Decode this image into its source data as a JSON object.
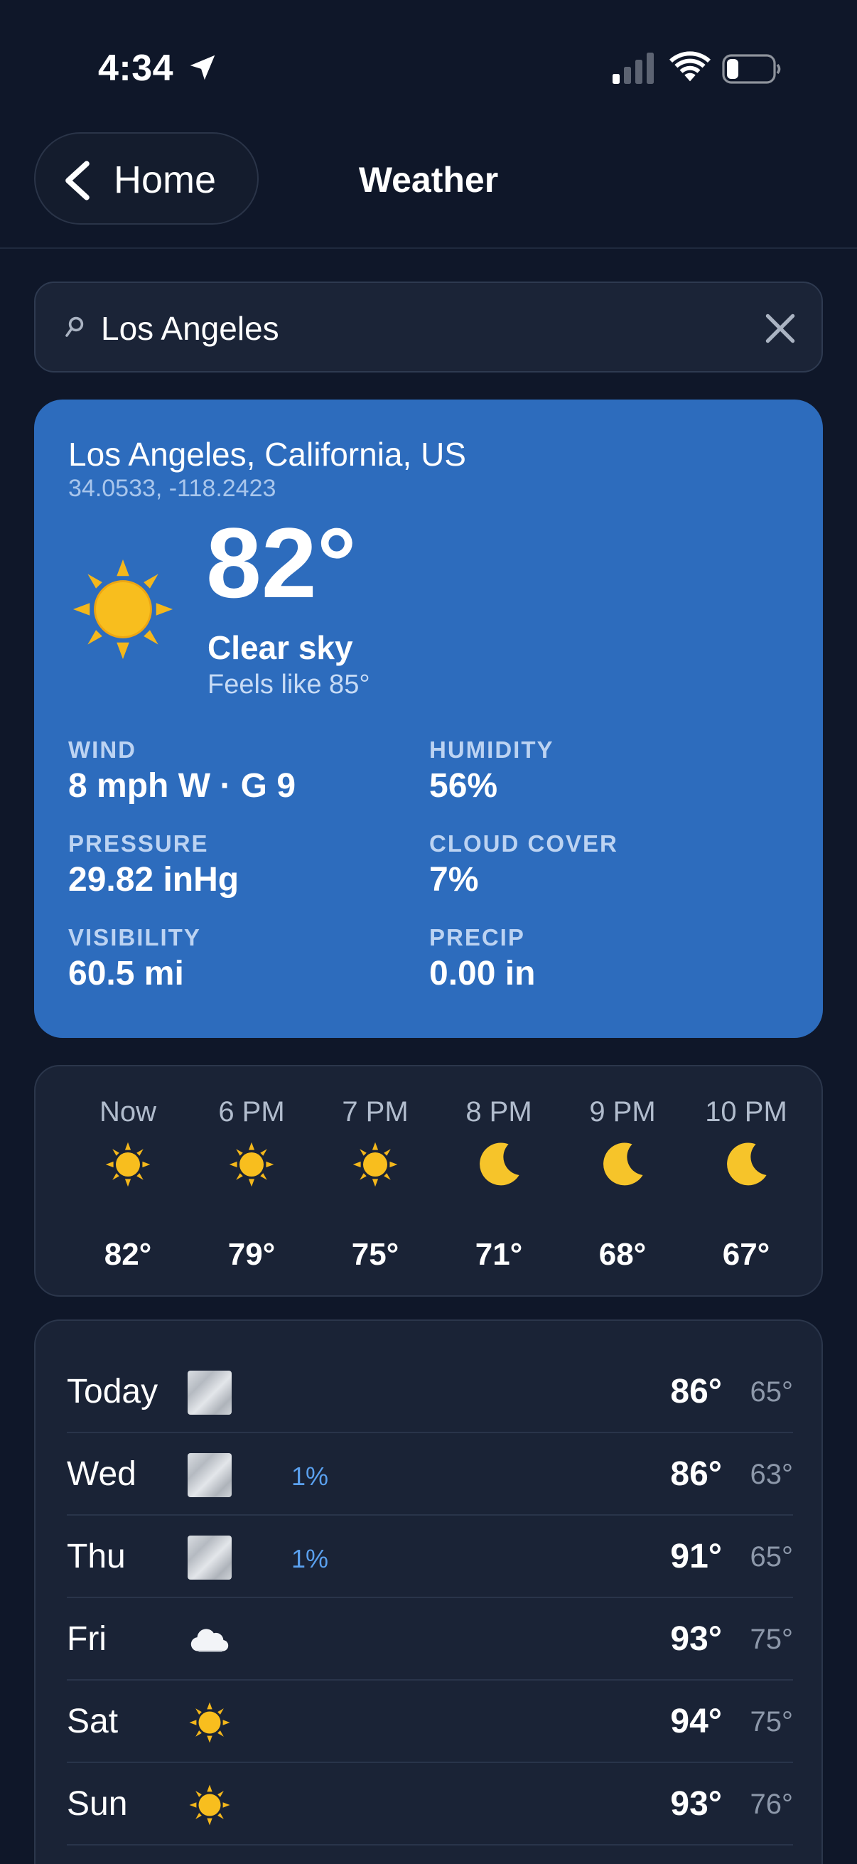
{
  "status_bar": {
    "time": "4:34"
  },
  "nav": {
    "back_label": "Home",
    "title": "Weather"
  },
  "search": {
    "value": "Los Angeles",
    "placeholder": ""
  },
  "current": {
    "location": "Los Angeles, California, US",
    "coords": "34.0533, -118.2423",
    "temperature": "82°",
    "condition": "Clear sky",
    "feels_like": "Feels like 85°",
    "icon": "sun-icon",
    "metrics": [
      {
        "label": "WIND",
        "value": "8 mph W · G 9"
      },
      {
        "label": "HUMIDITY",
        "value": "56%"
      },
      {
        "label": "PRESSURE",
        "value": "29.82 inHg"
      },
      {
        "label": "CLOUD COVER",
        "value": "7%"
      },
      {
        "label": "VISIBILITY",
        "value": "60.5 mi"
      },
      {
        "label": "PRECIP",
        "value": "0.00 in"
      }
    ]
  },
  "hourly": [
    {
      "time": "Now",
      "icon": "sun-icon",
      "temp": "82°"
    },
    {
      "time": "6 PM",
      "icon": "sun-icon",
      "temp": "79°"
    },
    {
      "time": "7 PM",
      "icon": "sun-icon",
      "temp": "75°"
    },
    {
      "time": "8 PM",
      "icon": "moon-icon",
      "temp": "71°"
    },
    {
      "time": "9 PM",
      "icon": "moon-icon",
      "temp": "68°"
    },
    {
      "time": "10 PM",
      "icon": "moon-icon",
      "temp": "67°"
    }
  ],
  "daily": [
    {
      "day": "Today",
      "icon": "fog-icon",
      "precip": "",
      "high": "86°",
      "low": "65°"
    },
    {
      "day": "Wed",
      "icon": "fog-icon",
      "precip": "1%",
      "high": "86°",
      "low": "63°"
    },
    {
      "day": "Thu",
      "icon": "fog-icon",
      "precip": "1%",
      "high": "91°",
      "low": "65°"
    },
    {
      "day": "Fri",
      "icon": "cloud-icon",
      "precip": "",
      "high": "93°",
      "low": "75°"
    },
    {
      "day": "Sat",
      "icon": "sun-icon",
      "precip": "",
      "high": "94°",
      "low": "75°"
    },
    {
      "day": "Sun",
      "icon": "sun-icon",
      "precip": "",
      "high": "93°",
      "low": "76°"
    }
  ],
  "colors": {
    "background": "#0f1729",
    "card_blue": "#2d6cbd",
    "panel": "#1a2336",
    "precip_blue": "#5aa0ee",
    "sun_yellow": "#f5b321"
  }
}
